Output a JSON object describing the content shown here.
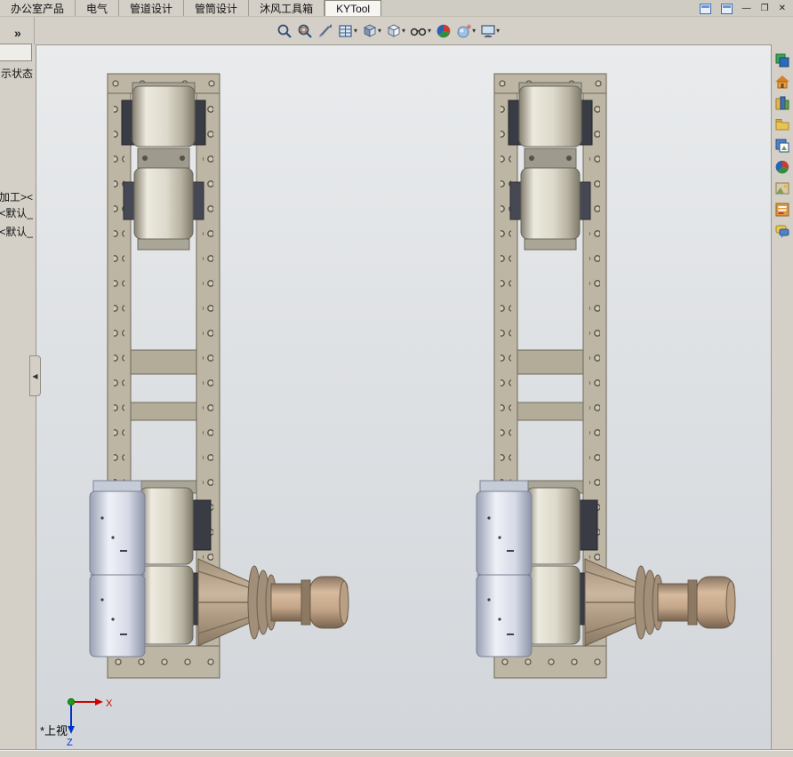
{
  "tabs": [
    {
      "label": "办公室产品",
      "active": false
    },
    {
      "label": "电气",
      "active": false
    },
    {
      "label": "管道设计",
      "active": false
    },
    {
      "label": "管筒设计",
      "active": false
    },
    {
      "label": "沐风工具箱",
      "active": false
    },
    {
      "label": "KYTool",
      "active": true
    }
  ],
  "window_controls": {
    "minimize": "—",
    "restore": "❐",
    "close": "✕",
    "mini_icons": [
      "panel-window-icon",
      "panel-window-icon-2"
    ]
  },
  "toolbar": {
    "caret": "▾",
    "icons": [
      "zoom-fit",
      "zoom-area",
      "pen",
      "section-view",
      "view-orientation",
      "display-style",
      "hide-show-items",
      "edit-appearance",
      "apply-scene",
      "view-settings"
    ]
  },
  "left_panel": {
    "expand_glyph": "»",
    "collapse_glyph": "◀",
    "display_state_fragment": "示状态",
    "tree_fragments": [
      "加工><",
      "<默认_",
      "<默认_"
    ]
  },
  "viewport": {
    "view_label": "*上视",
    "triad": {
      "x": "X",
      "z": "Z"
    },
    "models": [
      "roller-frame-assembly-left",
      "roller-frame-assembly-right"
    ]
  },
  "task_pane": {
    "icons": [
      "resources",
      "home",
      "design-library",
      "file-explorer",
      "view-palette",
      "appearances",
      "scenes",
      "custom-properties",
      "forum"
    ]
  },
  "colors": {
    "chrome": "#d4d0c8",
    "frame_tan": "#bdb6a4",
    "roller_light": "#ece9de",
    "gearbox_blue": "#eff1f7",
    "shaft_brown": "#c3a487",
    "triad_x": "#cc0000",
    "triad_z": "#0033cc",
    "triad_origin": "#1a9e1a"
  }
}
